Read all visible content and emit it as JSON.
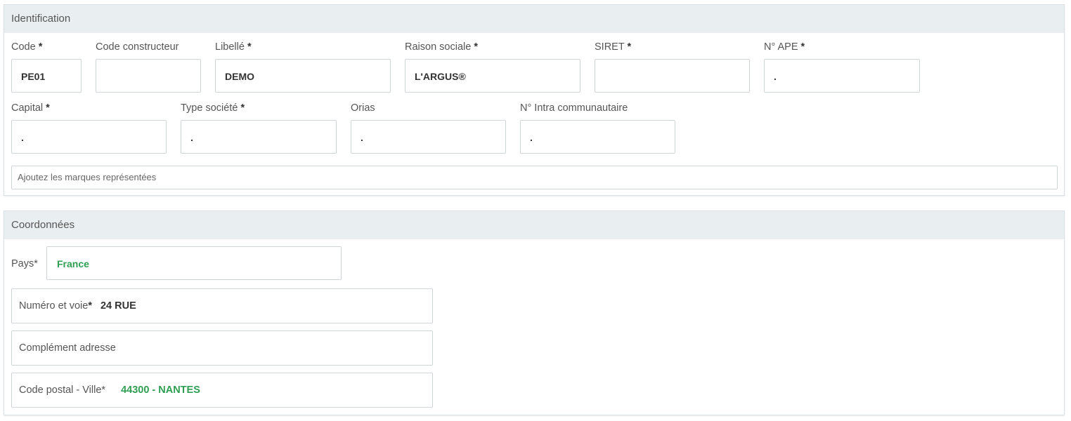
{
  "identification": {
    "title": "Identification",
    "fields": {
      "code": {
        "label": "Code",
        "req": "*",
        "value": "PE01"
      },
      "code_constructeur": {
        "label": "Code constructeur",
        "value": ""
      },
      "libelle": {
        "label": "Libellé",
        "req": "*",
        "value": "DEMO"
      },
      "raison_sociale": {
        "label": "Raison sociale",
        "req": "*",
        "value": "L'ARGUS®"
      },
      "siret": {
        "label": "SIRET",
        "req": "*",
        "value": ""
      },
      "ape": {
        "label": "N° APE",
        "req": "*",
        "value": "."
      },
      "capital": {
        "label": "Capital",
        "req": "*",
        "value": "."
      },
      "type_societe": {
        "label": "Type société",
        "req": "*",
        "value": "."
      },
      "orias": {
        "label": "Orias",
        "value": "."
      },
      "intra": {
        "label": "N° Intra communautaire",
        "value": "."
      }
    },
    "marques_placeholder": "Ajoutez les marques représentées"
  },
  "coordonnees": {
    "title": "Coordonnées",
    "pays": {
      "label": "Pays*",
      "value": "France"
    },
    "numero_voie": {
      "label": "Numéro et voie",
      "req": "*",
      "value": "24 RUE"
    },
    "complement": {
      "label": "Complément adresse",
      "value": ""
    },
    "cp_ville": {
      "label": "Code postal - Ville*",
      "value": "44300 - NANTES"
    }
  },
  "colors": {
    "accent_green": "#2e9e52",
    "header_bg": "#e9eff1"
  }
}
